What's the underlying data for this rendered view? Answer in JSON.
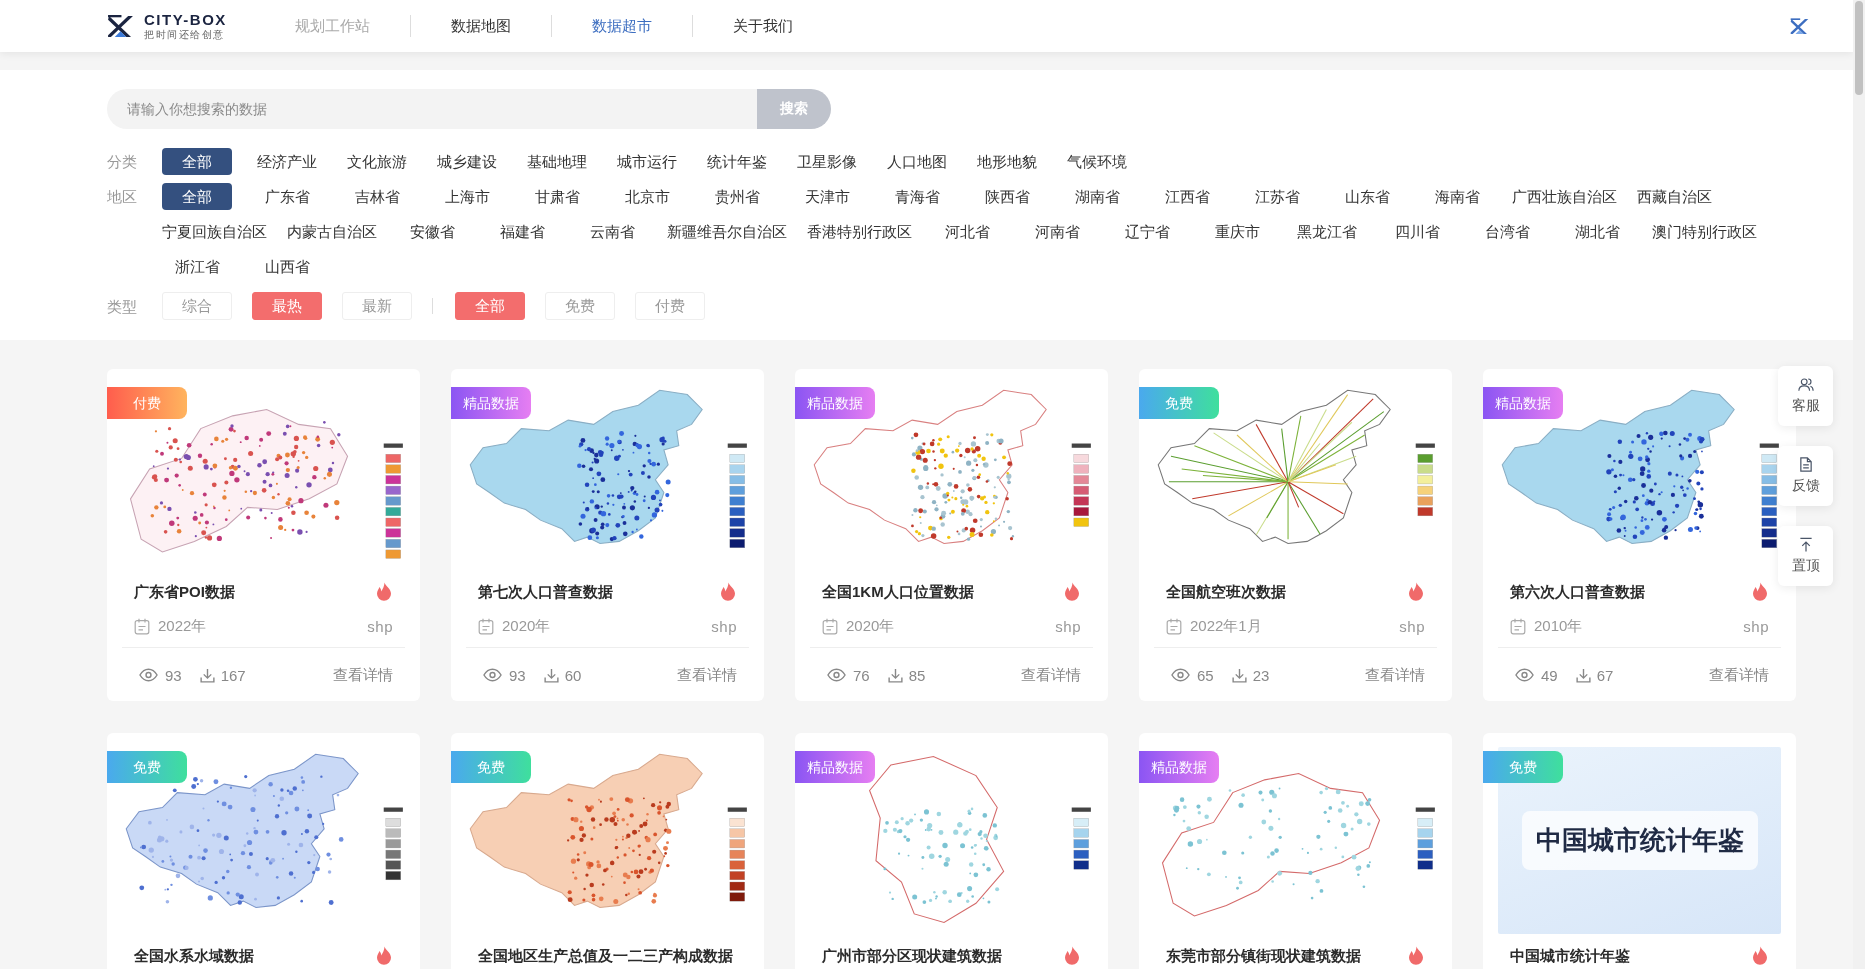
{
  "header": {
    "logo": {
      "name": "CITY-BOX",
      "tagline": "把时间还给创意"
    },
    "nav": [
      {
        "label": "规划工作站",
        "selected": false,
        "disabled": true
      },
      {
        "label": "数据地图",
        "selected": false,
        "disabled": false
      },
      {
        "label": "数据超市",
        "selected": true,
        "disabled": false
      },
      {
        "label": "关于我们",
        "selected": false,
        "disabled": false
      }
    ]
  },
  "search": {
    "placeholder": "请输入你想搜索的数据",
    "button": "搜索"
  },
  "filters": [
    {
      "label": "分类",
      "options": [
        {
          "label": "全部",
          "selected": true
        },
        {
          "label": "经济产业",
          "selected": false
        },
        {
          "label": "文化旅游",
          "selected": false
        },
        {
          "label": "城乡建设",
          "selected": false
        },
        {
          "label": "基础地理",
          "selected": false
        },
        {
          "label": "城市运行",
          "selected": false
        },
        {
          "label": "统计年鉴",
          "selected": false
        },
        {
          "label": "卫星影像",
          "selected": false
        },
        {
          "label": "人口地图",
          "selected": false
        },
        {
          "label": "地形地貌",
          "selected": false
        },
        {
          "label": "气候环境",
          "selected": false
        }
      ]
    },
    {
      "label": "地区",
      "options": [
        {
          "label": "全部",
          "selected": true
        },
        {
          "label": "广东省",
          "selected": false
        },
        {
          "label": "吉林省",
          "selected": false
        },
        {
          "label": "上海市",
          "selected": false
        },
        {
          "label": "甘肃省",
          "selected": false
        },
        {
          "label": "北京市",
          "selected": false
        },
        {
          "label": "贵州省",
          "selected": false
        },
        {
          "label": "天津市",
          "selected": false
        },
        {
          "label": "青海省",
          "selected": false
        },
        {
          "label": "陕西省",
          "selected": false
        },
        {
          "label": "湖南省",
          "selected": false
        },
        {
          "label": "江西省",
          "selected": false
        },
        {
          "label": "江苏省",
          "selected": false
        },
        {
          "label": "山东省",
          "selected": false
        },
        {
          "label": "海南省",
          "selected": false
        },
        {
          "label": "广西壮族自治区",
          "selected": false
        },
        {
          "label": "西藏自治区",
          "selected": false
        },
        {
          "label": "宁夏回族自治区",
          "selected": false
        },
        {
          "label": "内蒙古自治区",
          "selected": false
        },
        {
          "label": "安徽省",
          "selected": false
        },
        {
          "label": "福建省",
          "selected": false
        },
        {
          "label": "云南省",
          "selected": false
        },
        {
          "label": "新疆维吾尔自治区",
          "selected": false
        },
        {
          "label": "香港特别行政区",
          "selected": false
        },
        {
          "label": "河北省",
          "selected": false
        },
        {
          "label": "河南省",
          "selected": false
        },
        {
          "label": "辽宁省",
          "selected": false
        },
        {
          "label": "重庆市",
          "selected": false
        },
        {
          "label": "黑龙江省",
          "selected": false
        },
        {
          "label": "四川省",
          "selected": false
        },
        {
          "label": "台湾省",
          "selected": false
        },
        {
          "label": "湖北省",
          "selected": false
        },
        {
          "label": "澳门特别行政区",
          "selected": false
        },
        {
          "label": "浙江省",
          "selected": false
        },
        {
          "label": "山西省",
          "selected": false
        }
      ]
    }
  ],
  "type_filter": {
    "label": "类型",
    "groups": [
      {
        "options": [
          {
            "label": "综合",
            "selected": false
          },
          {
            "label": "最热",
            "selected": true
          },
          {
            "label": "最新",
            "selected": false
          }
        ]
      },
      {
        "options": [
          {
            "label": "全部",
            "selected": true
          },
          {
            "label": "免费",
            "selected": false
          },
          {
            "label": "付费",
            "selected": false
          }
        ]
      }
    ]
  },
  "cards": [
    {
      "badge": {
        "kind": "paid",
        "label": "付费"
      },
      "title": "广东省POI数据",
      "hot": true,
      "date": "2022年",
      "format": "shp",
      "views": "93",
      "downloads": "167",
      "link": "查看详情"
    },
    {
      "badge": {
        "kind": "premium",
        "label": "精品数据"
      },
      "title": "第七次人口普查数据",
      "hot": true,
      "date": "2020年",
      "format": "shp",
      "views": "93",
      "downloads": "60",
      "link": "查看详情"
    },
    {
      "badge": {
        "kind": "premium",
        "label": "精品数据"
      },
      "title": "全国1KM人口位置数据",
      "hot": true,
      "date": "2020年",
      "format": "shp",
      "views": "76",
      "downloads": "85",
      "link": "查看详情"
    },
    {
      "badge": {
        "kind": "free",
        "label": "免费"
      },
      "title": "全国航空班次数据",
      "hot": true,
      "date": "2022年1月",
      "format": "shp",
      "views": "65",
      "downloads": "23",
      "link": "查看详情"
    },
    {
      "badge": {
        "kind": "premium",
        "label": "精品数据"
      },
      "title": "第六次人口普查数据",
      "hot": true,
      "date": "2010年",
      "format": "shp",
      "views": "49",
      "downloads": "67",
      "link": "查看详情"
    },
    {
      "badge": {
        "kind": "free",
        "label": "免费"
      },
      "title": "全国水系水域数据",
      "hot": true
    },
    {
      "badge": {
        "kind": "free",
        "label": "免费"
      },
      "title": "全国地区生产总值及一二三产构成数据",
      "hot": false
    },
    {
      "badge": {
        "kind": "premium",
        "label": "精品数据"
      },
      "title": "广州市部分区现状建筑数据",
      "hot": true
    },
    {
      "badge": {
        "kind": "premium",
        "label": "精品数据"
      },
      "title": "东莞市部分镇街现状建筑数据",
      "hot": true
    },
    {
      "badge": {
        "kind": "free",
        "label": "免费"
      },
      "title": "中国城市统计年鉴",
      "hot": true,
      "cover_text": "中国城市统计年鉴"
    }
  ],
  "side_tools": [
    {
      "kind": "service",
      "label": "客服"
    },
    {
      "kind": "feedback",
      "label": "反馈"
    },
    {
      "kind": "top",
      "label": "置顶"
    }
  ]
}
